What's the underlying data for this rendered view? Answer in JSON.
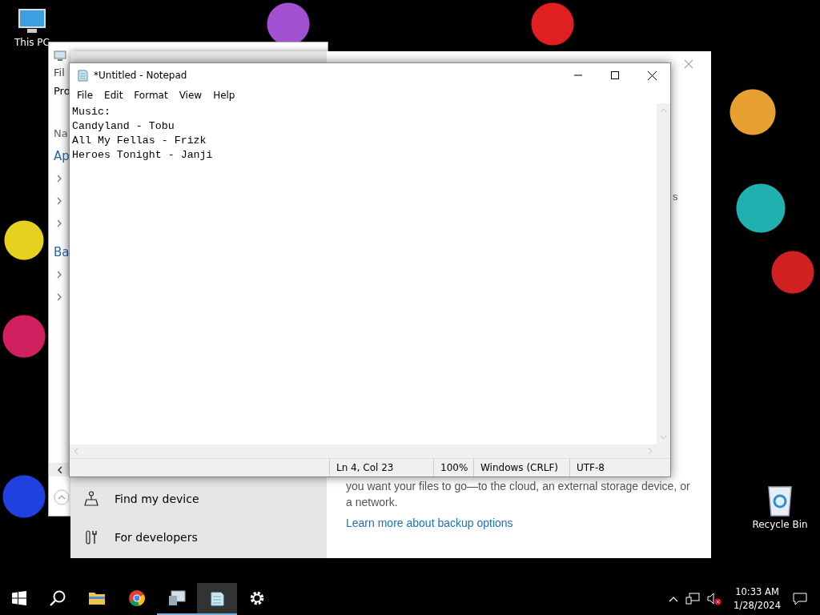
{
  "desktop": {
    "icons": [
      {
        "label": "This PC",
        "kind": "computer"
      },
      {
        "label": "Recycle Bin",
        "kind": "bin"
      }
    ]
  },
  "back_window": {
    "menu": "Fil",
    "tab": "Pro",
    "column": "Na",
    "groups": [
      {
        "label": "Ap",
        "rows": [
          {
            "expanded": false
          },
          {
            "expanded": false
          },
          {
            "expanded": false
          }
        ]
      },
      {
        "label": "Ba",
        "rows": [
          {
            "expanded": false
          },
          {
            "expanded": false
          }
        ]
      }
    ]
  },
  "settings": {
    "nav": [
      {
        "label": "Find my device",
        "kind": "find"
      },
      {
        "label": "For developers",
        "kind": "tools"
      }
    ],
    "fragment": "s",
    "paragraph": "you want your files to go—to the cloud, an external storage device, or a network.",
    "link": "Learn more about backup options"
  },
  "notepad": {
    "title": "*Untitled - Notepad",
    "menu": [
      "File",
      "Edit",
      "Format",
      "View",
      "Help"
    ],
    "lines": [
      "Music:",
      "Candyland - Tobu",
      "All My Fellas - Frizk",
      "Heroes Tonight - Janji"
    ],
    "status": [
      "Ln 4, Col 23",
      "100%",
      "Windows (CRLF)",
      "UTF-8"
    ]
  },
  "taskbar": {
    "apps": [
      {
        "kind": "start",
        "running": false,
        "selected": false
      },
      {
        "kind": "search",
        "running": false,
        "selected": false
      },
      {
        "kind": "folder",
        "running": false,
        "selected": false
      },
      {
        "kind": "browser",
        "running": false,
        "selected": false
      },
      {
        "kind": "panel",
        "running": true,
        "selected": false
      },
      {
        "kind": "notepad",
        "running": true,
        "selected": true
      },
      {
        "kind": "gear",
        "running": false,
        "selected": false
      }
    ],
    "time": "10:33 AM",
    "date": "1/28/2024"
  }
}
